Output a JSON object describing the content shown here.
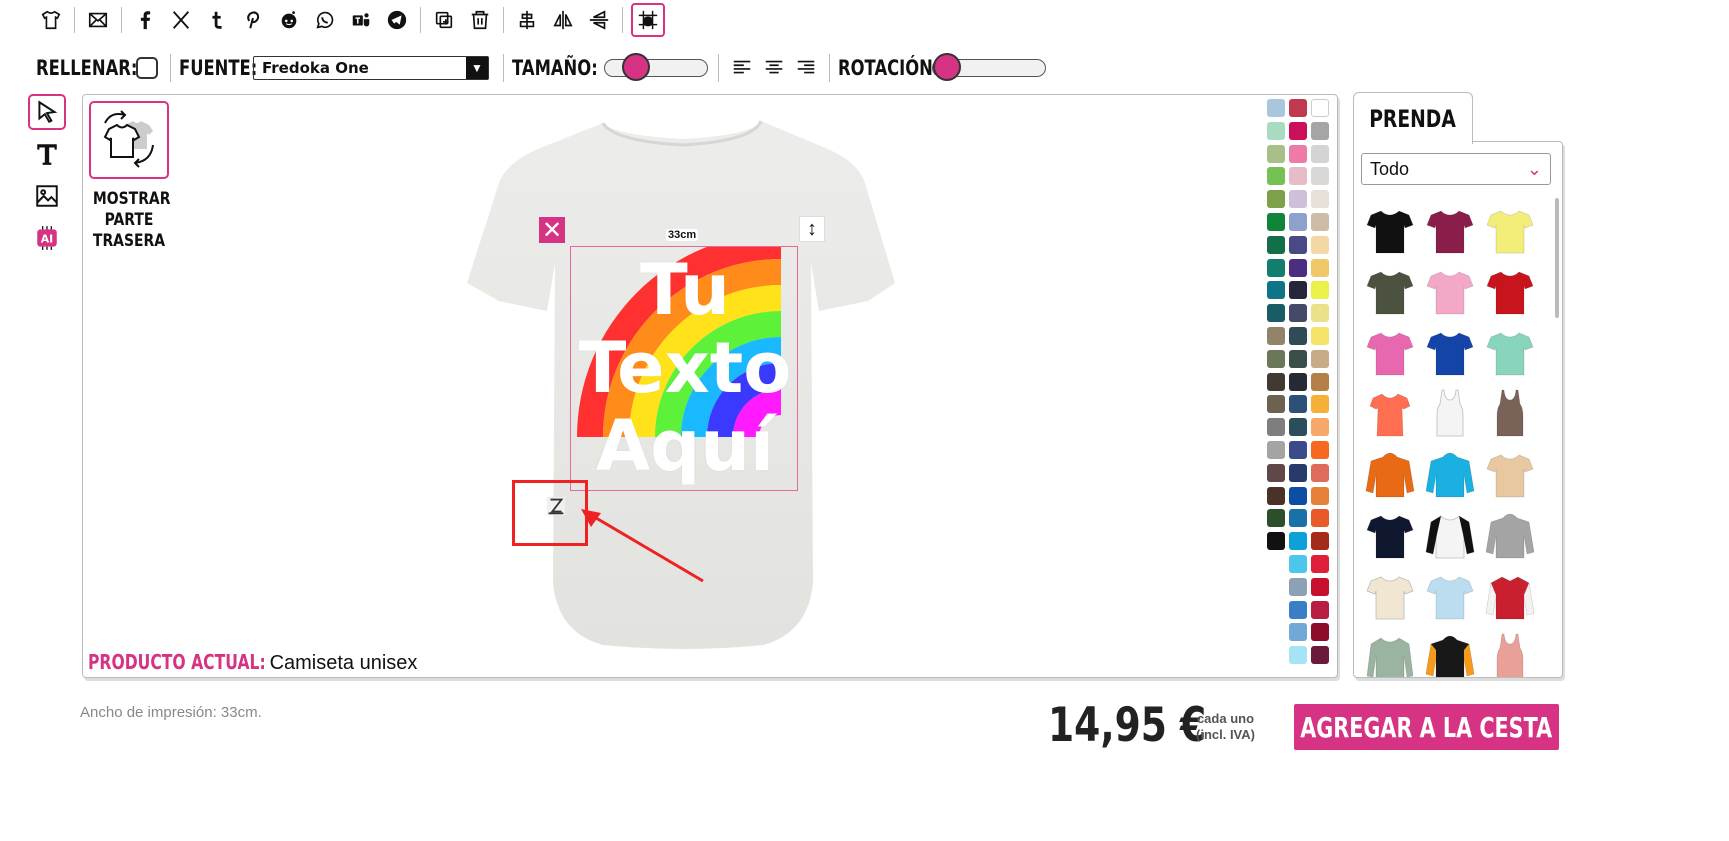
{
  "toolbar2": {
    "fill_label": "RELLENAR:",
    "font_label": "FUENTE:",
    "font_value": "Fredoka One",
    "size_label": "TAMAÑO:",
    "rotation_label": "ROTACIÓN:",
    "size_level": 0.22,
    "rotation_level": 0.0
  },
  "canvas": {
    "show_back_label": "MOSTRAR PARTE TRASERA",
    "design_text": [
      "Tu",
      "Texto",
      "Aquí"
    ],
    "width_badge": "33cm",
    "product_label": "PRODUCTO ACTUAL:",
    "product_value": "Camiseta unisex"
  },
  "swatch_colors": [
    "#a9c6dd",
    "#c0394f",
    "#ffffff",
    "#a8dcc0",
    "#cc0f5a",
    "#a5a5a5",
    "#a8c088",
    "#ee7aa8",
    "#d4d4d4",
    "#77c054",
    "#e6bcc8",
    "#d9d7d5",
    "#7ea04a",
    "#cec0d8",
    "#e6e0d6",
    "#108438",
    "#8ea0cc",
    "#cfbca6",
    "#127048",
    "#474a84",
    "#f3d8a6",
    "#127e6e",
    "#4c2e80",
    "#efc668",
    "#107488",
    "#27253a",
    "#ebf04a",
    "#195c66",
    "#444a68",
    "#ece088",
    "#928468",
    "#304a56",
    "#f5e468",
    "#6c7658",
    "#3c4e4a",
    "#c8ac88",
    "#403a30",
    "#262a36",
    "#b48048",
    "#6c6250",
    "#2c5078",
    "#f5b038",
    "#7e7e7e",
    "#2c4e5a",
    "#f5a868",
    "#a4a4a4",
    "#3a4a8a",
    "#f56a20",
    "#604848",
    "#283a6a",
    "#e06a5c",
    "#4a3228",
    "#0c4ea4",
    "#e48038",
    "#2c4e2a",
    "#1c70a8",
    "#e85a2a",
    "#111111",
    "#0ea0d8",
    "#a42a1a",
    "",
    "#4cc6ea",
    "#e0203a",
    "",
    "#8ca2b4",
    "#c8102e",
    "",
    "#3a7ec6",
    "#b81e42",
    "",
    "#70a8d8",
    "#8c0c2a",
    "",
    "#a4e4f4",
    "#6c1a3a"
  ],
  "panel": {
    "tab": "PRENDA",
    "filter": "Todo",
    "garments": [
      {
        "type": "tshirt",
        "color": "#111111"
      },
      {
        "type": "tshirt",
        "color": "#8b1d4b"
      },
      {
        "type": "tshirt",
        "color": "#f3ee7a"
      },
      {
        "type": "tshirt",
        "color": "#4c5240"
      },
      {
        "type": "tshirt",
        "color": "#f3a8c8"
      },
      {
        "type": "tshirt",
        "color": "#c8141c"
      },
      {
        "type": "tshirt",
        "color": "#e868b0"
      },
      {
        "type": "tshirt",
        "color": "#1444a8"
      },
      {
        "type": "tshirt",
        "color": "#88d4bc"
      },
      {
        "type": "tshirt-fitted",
        "color": "#ff6e50"
      },
      {
        "type": "tank",
        "color": "#f4f4f4"
      },
      {
        "type": "tank",
        "color": "#7a6258"
      },
      {
        "type": "hoodie",
        "color": "#e86a14"
      },
      {
        "type": "hoodie",
        "color": "#1ab0e0"
      },
      {
        "type": "tshirt",
        "color": "#e8c8a0"
      },
      {
        "type": "tshirt",
        "color": "#101830"
      },
      {
        "type": "raglan",
        "color": "#f4f4f4"
      },
      {
        "type": "hoodie",
        "color": "#a4a4a4"
      },
      {
        "type": "tshirt",
        "color": "#f0e6d2"
      },
      {
        "type": "tshirt",
        "color": "#bcdcf0"
      },
      {
        "type": "jacket",
        "color": "#c8202e"
      },
      {
        "type": "longsleeve",
        "color": "#9ab4a0"
      },
      {
        "type": "hoodie",
        "color": "#181818"
      },
      {
        "type": "tank",
        "color": "#e8a098"
      }
    ]
  },
  "footer": {
    "print_width": "Ancho de impresión: 33cm.",
    "price": "14,95 €",
    "price_note_1": "cada uno",
    "price_note_2": "(incl. IVA)",
    "add_to_cart": "AGREGAR A LA CESTA"
  }
}
